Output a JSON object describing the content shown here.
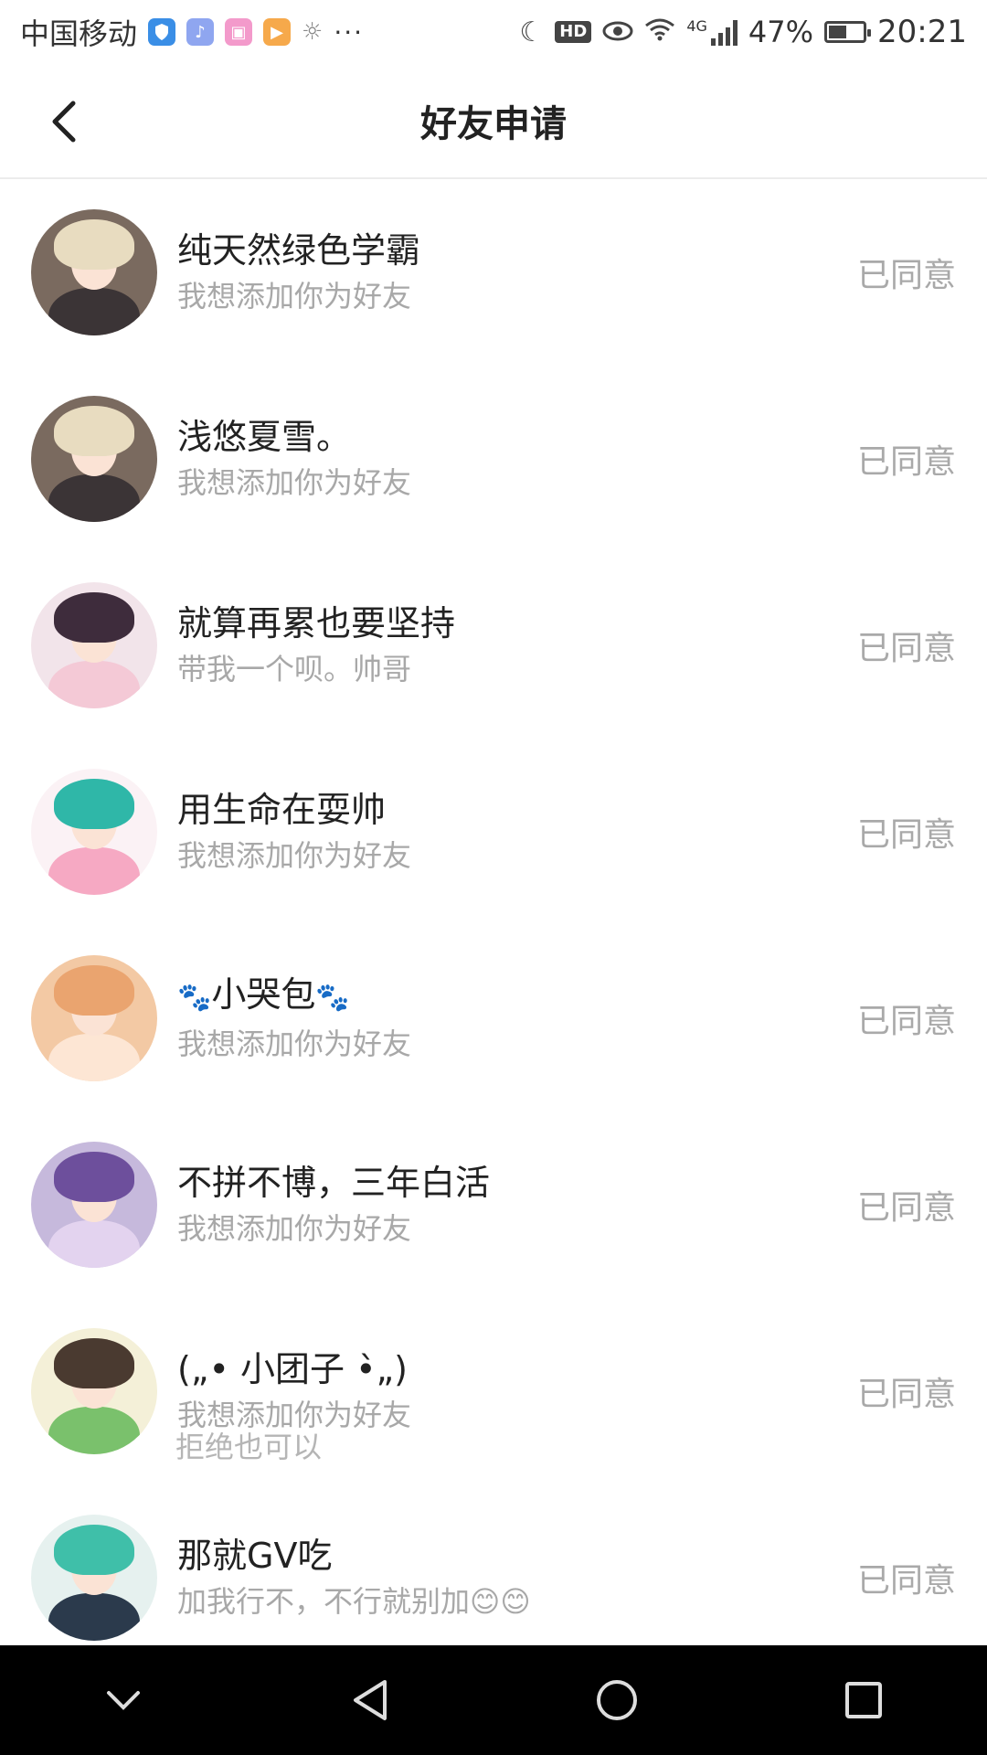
{
  "status_bar": {
    "carrier": "中国移动",
    "app_icons": [
      "shield-icon",
      "music-icon",
      "gift-icon",
      "video-icon",
      "sun-icon"
    ],
    "overflow": "···",
    "hd_label": "HD",
    "network": "4G",
    "battery_pct": "47%",
    "time": "20:21"
  },
  "header": {
    "title": "好友申请",
    "back_icon": "chevron-left-icon"
  },
  "requests": [
    {
      "name": "纯天然绿色学霸",
      "message": "我想添加你为好友",
      "status": "已同意",
      "avatar": {
        "bg": "#7a6a5f",
        "hair": "#e8dcc0",
        "body": "#3b3436"
      }
    },
    {
      "name": "浅悠夏雪。",
      "message": "我想添加你为好友",
      "status": "已同意",
      "avatar": {
        "bg": "#7a6a5f",
        "hair": "#e8dcc0",
        "body": "#3b3436"
      }
    },
    {
      "name": "就算再累也要坚持",
      "message": "带我一个呗。帅哥",
      "status": "已同意",
      "avatar": {
        "bg": "#f2e4ea",
        "hair": "#3e2c3c",
        "body": "#f4c9d6"
      }
    },
    {
      "name": "用生命在耍帅",
      "message": "我想添加你为好友",
      "status": "已同意",
      "avatar": {
        "bg": "#fbf2f5",
        "hair": "#2fb7a8",
        "body": "#f6a9c3"
      }
    },
    {
      "name": "小哭包",
      "name_prefix": "🐾",
      "name_suffix": "🐾",
      "message": "我想添加你为好友",
      "status": "已同意",
      "avatar": {
        "bg": "#f3c9a4",
        "hair": "#eaa46f",
        "body": "#fde6d4"
      }
    },
    {
      "name": "不拼不博，三年白活",
      "message": "我想添加你为好友",
      "status": "已同意",
      "avatar": {
        "bg": "#c6b9dc",
        "hair": "#6d4f9c",
        "body": "#e3d3ef"
      }
    },
    {
      "name": "(„• 小团子 •̀„)",
      "message": "我想添加你为好友",
      "status": "已同意",
      "avatar": {
        "bg": "#f4f0d8",
        "hair": "#4a3a30",
        "body": "#7ac16c"
      }
    },
    {
      "name": "那就GV吃",
      "message": "加我行不，不行就别加😊😊",
      "status": "已同意",
      "avatar": {
        "bg": "#e6f1ef",
        "hair": "#3fbfa9",
        "body": "#2b3a4c"
      }
    }
  ],
  "partial_text": "拒绝也可以",
  "nav_bar": {
    "buttons": [
      "chevron-down-icon",
      "back-triangle-icon",
      "home-circle-icon",
      "recents-square-icon"
    ]
  }
}
